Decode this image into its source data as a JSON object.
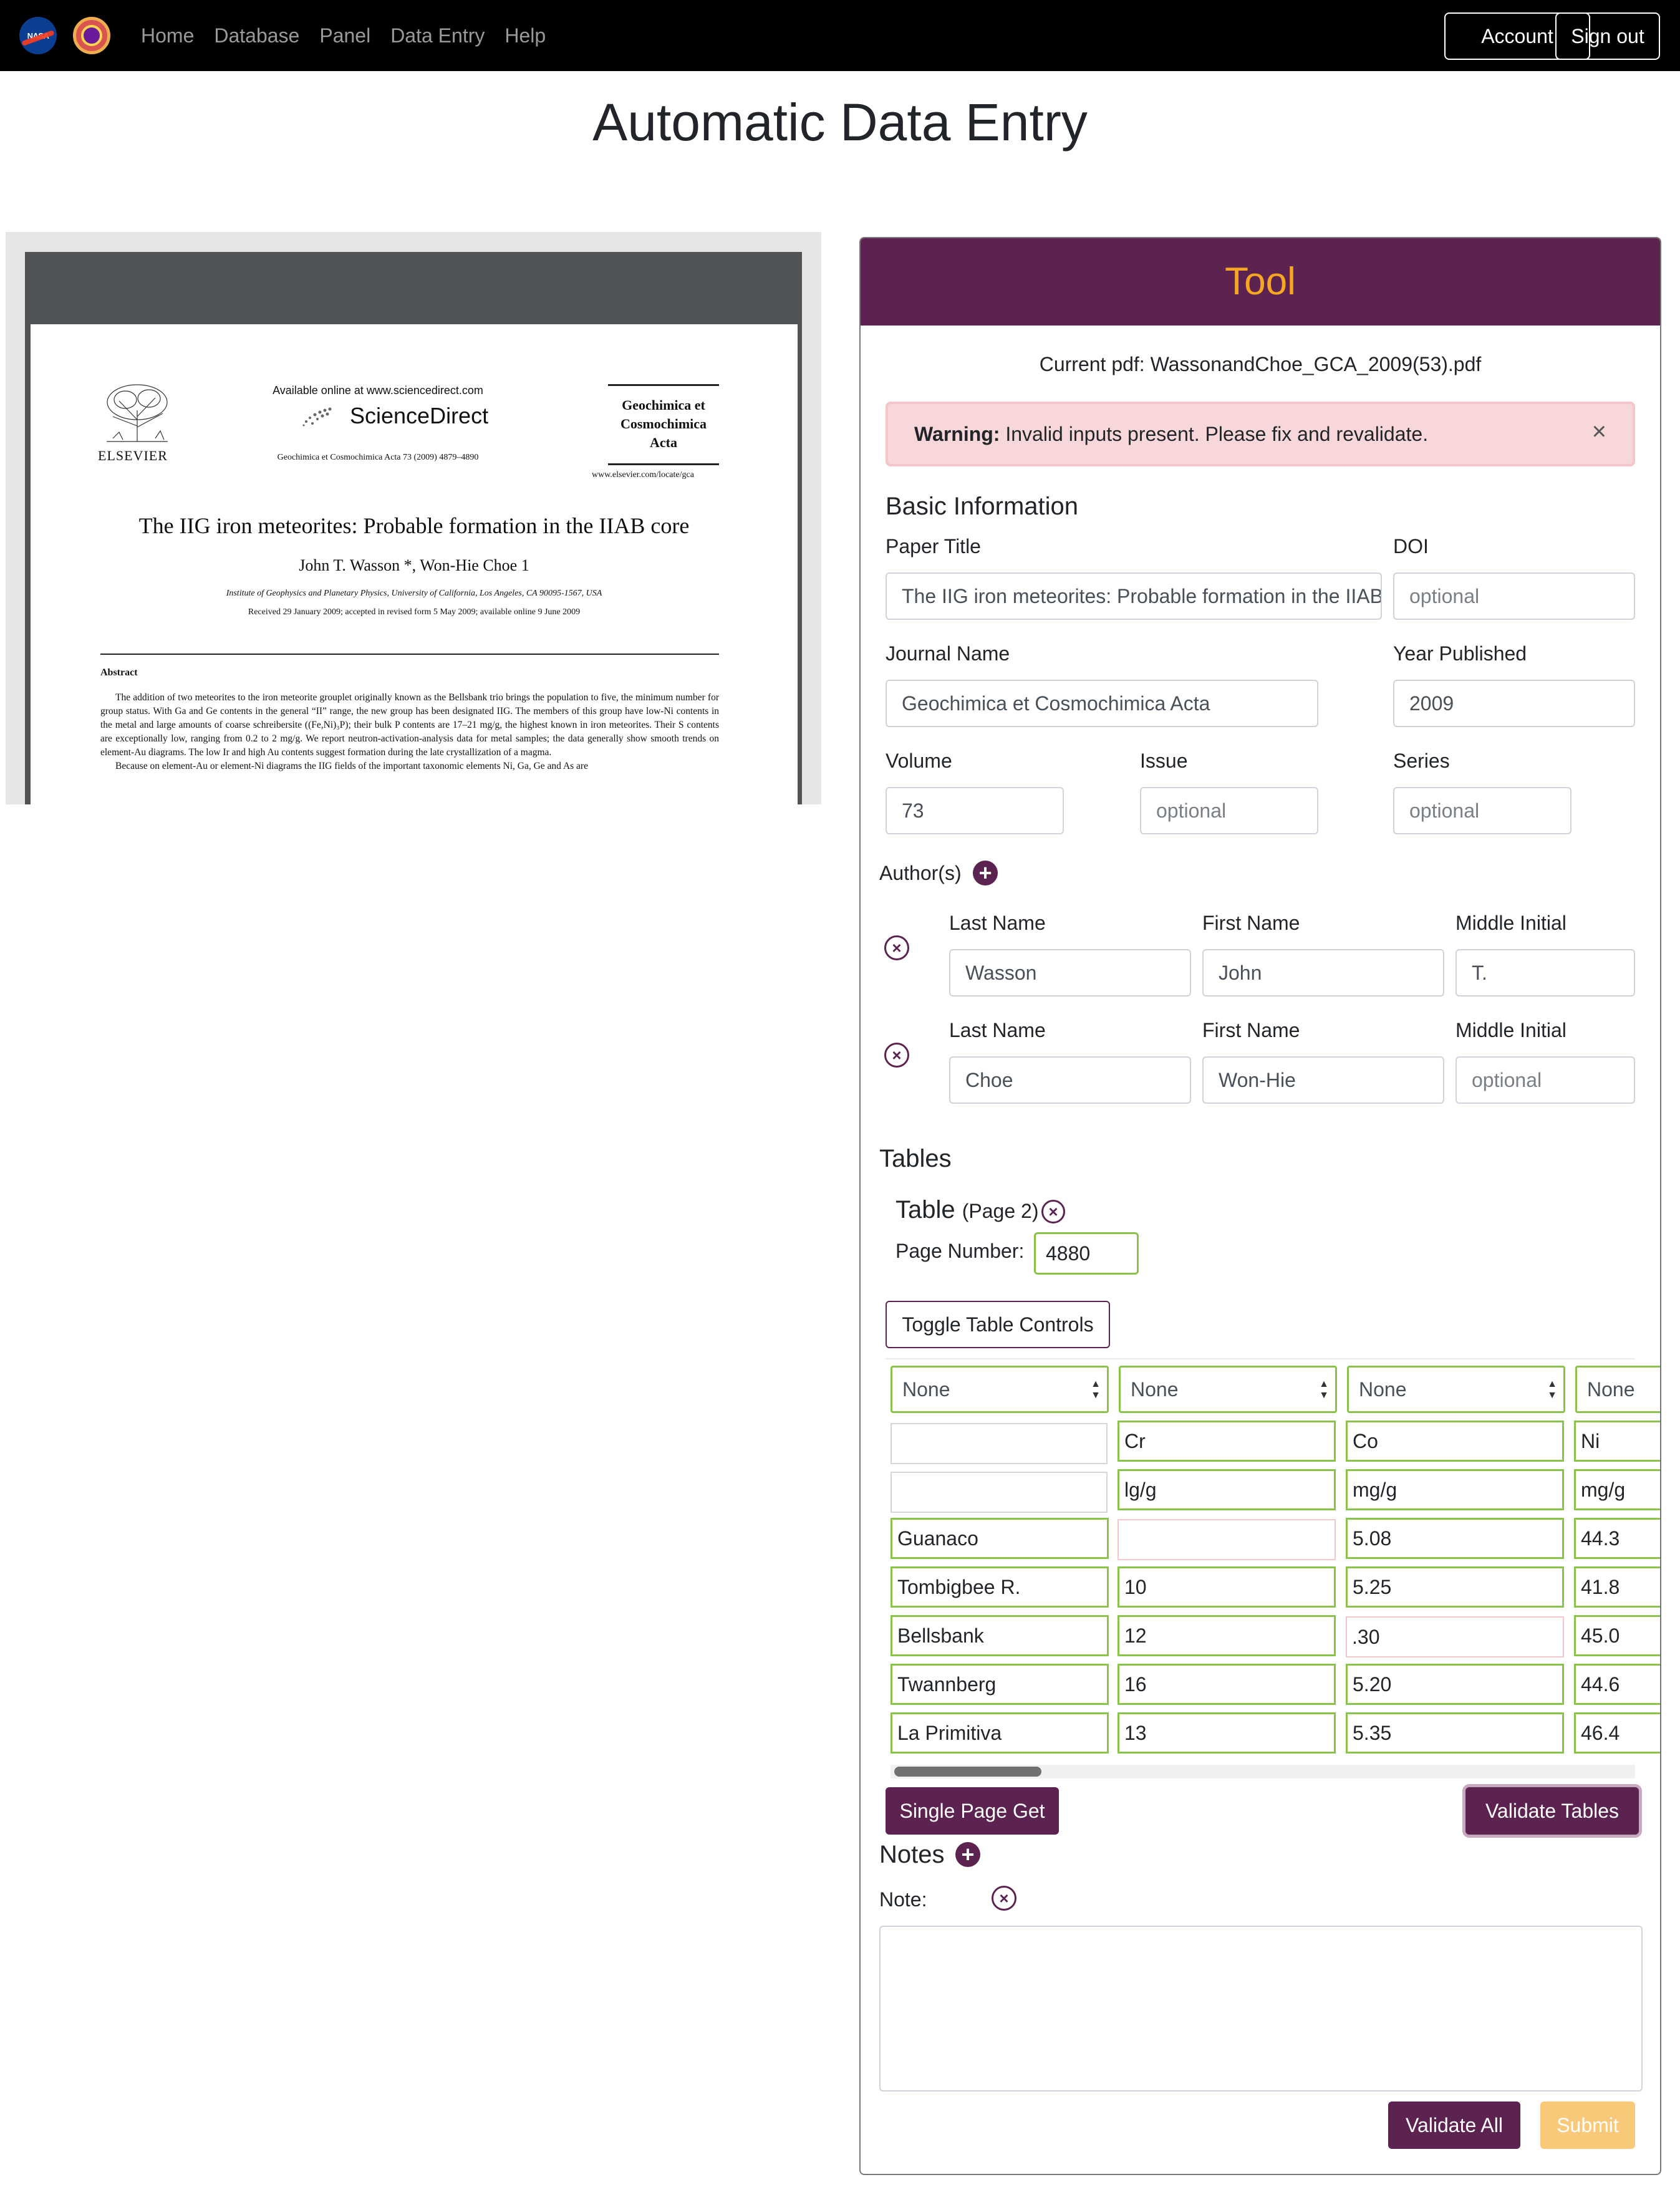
{
  "nav": {
    "logos": [
      "nasa-logo",
      "project-logo"
    ],
    "links": [
      "Home",
      "Database",
      "Panel",
      "Data Entry",
      "Help"
    ],
    "account": "Account",
    "signout": "Sign out"
  },
  "page": {
    "title": "Automatic Data Entry"
  },
  "pdf_preview": {
    "online": "Available online at www.sciencedirect.com",
    "sciencedirect": "ScienceDirect",
    "journal_line": "Geochimica et Cosmochimica Acta 73 (2009) 4879–4890",
    "elsevier": "ELSEVIER",
    "gca_logo": [
      "Geochimica et",
      "Cosmochimica",
      "Acta"
    ],
    "gca_url": "www.elsevier.com/locate/gca",
    "title": "The IIG iron meteorites: Probable formation in the IIAB core",
    "authors": "John T. Wasson *, Won-Hie Choe 1",
    "affiliation": "Institute of Geophysics and Planetary Physics, University of California, Los Angeles, CA 90095-1567, USA",
    "received": "Received 29 January 2009; accepted in revised form 5 May 2009; available online 9 June 2009",
    "abstract_heading": "Abstract",
    "abstract": "The addition of two meteorites to the iron meteorite grouplet originally known as the Bellsbank trio brings the population to five, the minimum number for group status. With Ga and Ge contents in the general “II” range, the new group has been designated IIG. The members of this group have low-Ni contents in the metal and large amounts of coarse schreibersite ((Fe,Ni)₃P); their bulk P contents are 17–21 mg/g, the highest known in iron meteorites. Their S contents are exceptionally low, ranging from 0.2 to 2 mg/g. We report neutron-activation-analysis data for metal samples; the data generally show smooth trends on element-Au diagrams. The low Ir and high Au contents suggest formation during the late crystallization of a magma.",
    "abstract2": "Because on element-Au or element-Ni diagrams the IIG fields of the important taxonomic elements Ni, Ga, Ge and As are"
  },
  "tool": {
    "header": "Tool",
    "current_pdf": "Current pdf: WassonandChoe_GCA_2009(53).pdf",
    "alert_strong": "Warning:",
    "alert_text": " Invalid inputs present. Please fix and revalidate.",
    "alert_close": "×",
    "basic_heading": "Basic Information",
    "paper_title_label": "Paper Title",
    "paper_title_value": "The IIG iron meteorites: Probable formation in the IIAB core",
    "doi_label": "DOI",
    "doi_placeholder": "optional",
    "journal_label": "Journal Name",
    "journal_value": "Geochimica et Cosmochimica Acta",
    "year_label": "Year Published",
    "year_value": "2009",
    "volume_label": "Volume",
    "volume_value": "73",
    "issue_label": "Issue",
    "issue_placeholder": "optional",
    "series_label": "Series",
    "series_placeholder": "optional",
    "authors_label": "Author(s)",
    "authors": [
      {
        "last_label": "Last Name",
        "first_label": "First Name",
        "middle_label": "Middle Initial",
        "last": "Wasson",
        "first": "John",
        "middle": "T.",
        "middle_placeholder": ""
      },
      {
        "last_label": "Last Name",
        "first_label": "First Name",
        "middle_label": "Middle Initial",
        "last": "Choe",
        "first": "Won-Hie",
        "middle": "",
        "middle_placeholder": "optional"
      }
    ],
    "tables_heading": "Tables",
    "table_label": "Table",
    "table_page_note": "(Page 2)",
    "page_number_label": "Page Number:",
    "page_number_value": "4880",
    "toggle_controls": "Toggle Table Controls",
    "column_selects": [
      "None",
      "None",
      "None",
      "None"
    ],
    "grid_rows": [
      [
        "",
        "Cr",
        "Co",
        "Ni"
      ],
      [
        "",
        "lg/g",
        "mg/g",
        "mg/g"
      ],
      [
        "Guanaco",
        "",
        "5.08",
        "44.3"
      ],
      [
        "Tombigbee R.",
        "10",
        "5.25",
        "41.8"
      ],
      [
        "Bellsbank",
        "12",
        ".30",
        "45.0"
      ],
      [
        "Twannberg",
        "16",
        "5.20",
        "44.6"
      ],
      [
        "La Primitiva",
        "13",
        "5.35",
        "46.4"
      ]
    ],
    "single_page_get": "Single Page Get",
    "validate_tables": "Validate Tables",
    "notes_heading": "Notes",
    "note_label": "Note:",
    "validate_all": "Validate All",
    "submit": "Submit"
  },
  "colors": {
    "navbar": "#000000",
    "tool_header_bg": "#5c2350",
    "tool_header_text": "#f6a623",
    "primary_button": "#5c2350",
    "submit_button": "#f9c97a",
    "valid_border": "#8ac34a",
    "alert_bg": "#f8d7da"
  }
}
